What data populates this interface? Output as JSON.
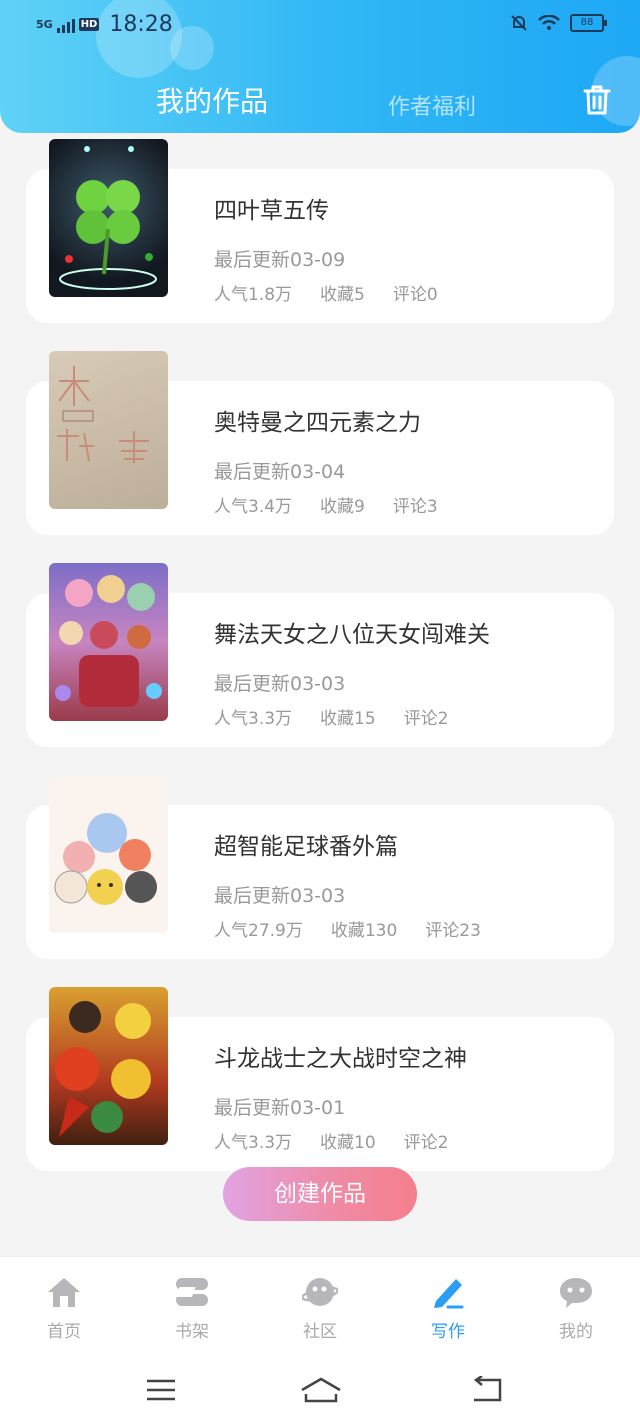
{
  "status_bar": {
    "network": "5G",
    "hd": "HD",
    "time": "18:28",
    "battery": "88"
  },
  "header": {
    "tab_active": "我的作品",
    "tab_inactive": "作者福利"
  },
  "works": [
    {
      "title": "四叶草五传",
      "updated": "最后更新03-09",
      "popularity": "人气1.8万",
      "favorites": "收藏5",
      "comments": "评论0"
    },
    {
      "title": "奥特曼之四元素之力",
      "updated": "最后更新03-04",
      "popularity": "人气3.4万",
      "favorites": "收藏9",
      "comments": "评论3"
    },
    {
      "title": "舞法天女之八位天女闯难关",
      "updated": "最后更新03-03",
      "popularity": "人气3.3万",
      "favorites": "收藏15",
      "comments": "评论2"
    },
    {
      "title": "超智能足球番外篇",
      "updated": "最后更新03-03",
      "popularity": "人气27.9万",
      "favorites": "收藏130",
      "comments": "评论23"
    },
    {
      "title": "斗龙战士之大战时空之神",
      "updated": "最后更新03-01",
      "popularity": "人气3.3万",
      "favorites": "收藏10",
      "comments": "评论2"
    }
  ],
  "create_button": "创建作品",
  "bottom_nav": [
    {
      "label": "首页",
      "icon": "home-icon"
    },
    {
      "label": "书架",
      "icon": "bookshelf-icon"
    },
    {
      "label": "社区",
      "icon": "community-icon"
    },
    {
      "label": "写作",
      "icon": "write-icon",
      "active": true
    },
    {
      "label": "我的",
      "icon": "profile-icon"
    }
  ],
  "colors": {
    "accent": "#2a9ef4",
    "header_start": "#5fd2f6",
    "header_end": "#1ea8f5",
    "button_start": "#e1a3e3",
    "button_end": "#f57f8c"
  }
}
